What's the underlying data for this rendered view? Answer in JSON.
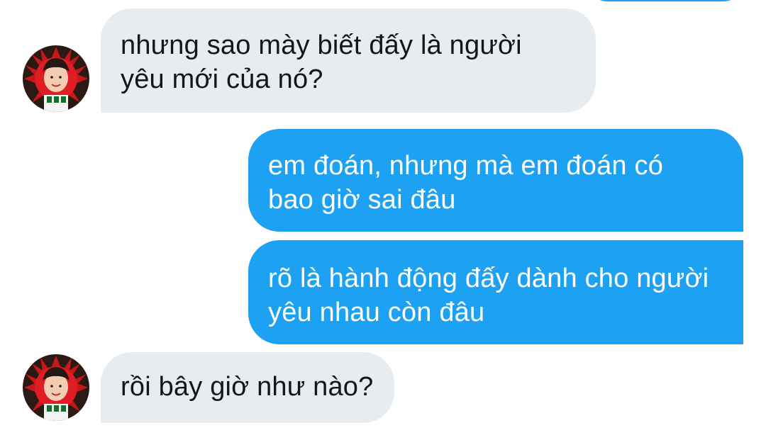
{
  "conversation": {
    "messages": [
      {
        "sender": "other",
        "lines": [
          "nhưng sao mày biết đấy là người",
          "yêu mới của nó?"
        ]
      },
      {
        "sender": "me",
        "lines": [
          "em đoán, nhưng mà em đoán có",
          "bao giờ sai đâu"
        ]
      },
      {
        "sender": "me",
        "lines": [
          "rõ là hành động đấy dành cho người",
          "yêu nhau còn đâu"
        ]
      },
      {
        "sender": "other",
        "lines": [
          "rồi bây giờ như nào?"
        ]
      }
    ]
  },
  "colors": {
    "incoming_bubble": "#e6ecf0",
    "outgoing_bubble": "#1da1f2",
    "incoming_text": "#14171a",
    "outgoing_text": "#ffffff"
  },
  "icons": {
    "avatar": "profile-photo-icon"
  }
}
